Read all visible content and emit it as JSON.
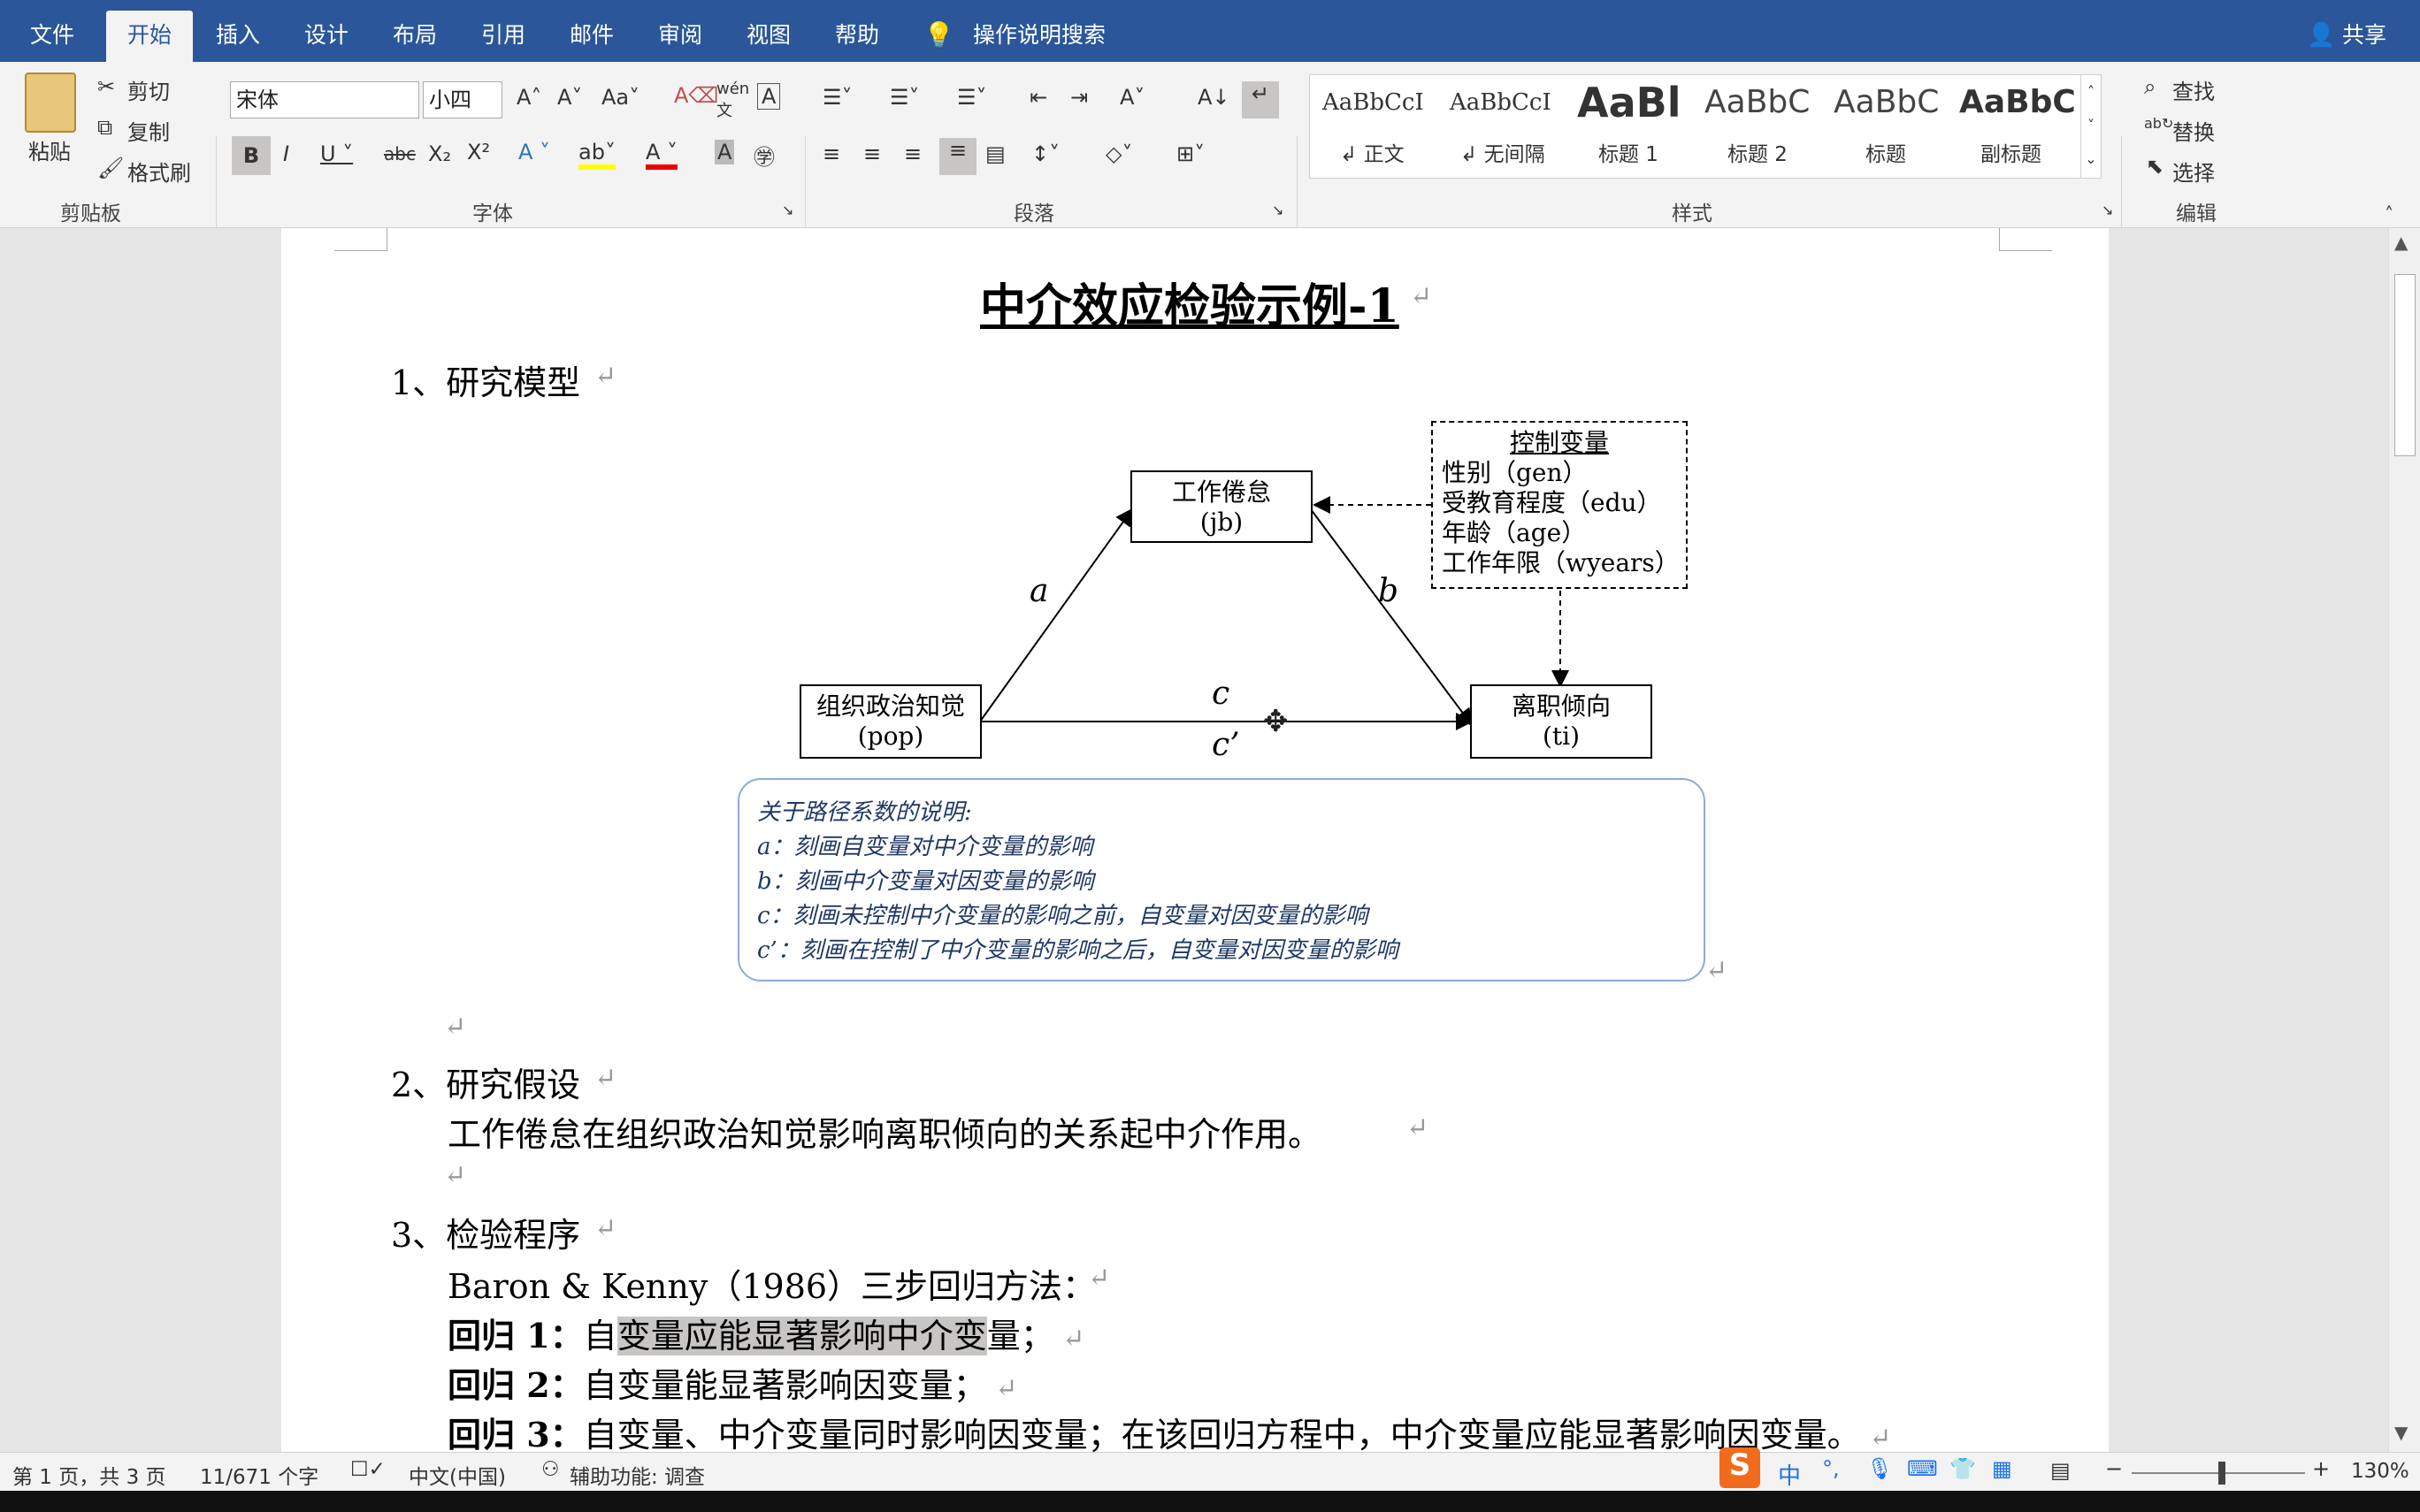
{
  "tabs": [
    "文件",
    "开始",
    "插入",
    "设计",
    "布局",
    "引用",
    "邮件",
    "审阅",
    "视图",
    "帮助"
  ],
  "active_tab": "开始",
  "tell_me": "操作说明搜索",
  "share": "共享",
  "clipboard": {
    "paste": "粘贴",
    "cut": "剪切",
    "copy": "复制",
    "format_painter": "格式刷",
    "group": "剪贴板"
  },
  "font": {
    "name": "宋体",
    "size": "小四",
    "group": "字体"
  },
  "paragraph": {
    "group": "段落"
  },
  "styles": {
    "group": "样式",
    "items": [
      {
        "preview": "AaBbCcI",
        "name": "↲ 正文"
      },
      {
        "preview": "AaBbCcI",
        "name": "↲ 无间隔"
      },
      {
        "preview": "AaBl",
        "name": "标题 1"
      },
      {
        "preview": "AaBbC",
        "name": "标题 2"
      },
      {
        "preview": "AaBbC",
        "name": "标题"
      },
      {
        "preview": "AaBbC",
        "name": "副标题"
      }
    ]
  },
  "editing": {
    "find": "查找",
    "replace": "替换",
    "select": "选择",
    "group": "编辑"
  },
  "document": {
    "title": "中介效应检验示例-1",
    "h1": "1、研究模型",
    "diagram": {
      "node_jb": [
        "工作倦怠",
        "(jb)"
      ],
      "node_pop": [
        "组织政治知觉",
        "(pop)"
      ],
      "node_ti": [
        "离职倾向",
        "(ti)"
      ],
      "control_title": "控制变量",
      "control_items": [
        "性别（gen）",
        "受教育程度（edu）",
        "年龄（age）",
        "工作年限（wyears）"
      ],
      "path_a": "a",
      "path_b": "b",
      "path_c": "c",
      "path_c2": "c’",
      "note_title": "关于路径系数的说明:",
      "notes": [
        "a：刻画自变量对中介变量的影响",
        "b：刻画中介变量对因变量的影响",
        "c：刻画未控制中介变量的影响之前，自变量对因变量的影响",
        "c’：刻画在控制了中介变量的影响之后，自变量对因变量的影响"
      ]
    },
    "h2": "2、研究假设",
    "hypothesis": "工作倦怠在组织政治知觉影响离职倾向的关系起中介作用。",
    "h3": "3、检验程序",
    "method": "Baron & Kenny（1986）三步回归方法：",
    "reg1_label": "回归 1：",
    "reg1_pre": "自",
    "reg1_hl": "变量应能显著影响中介变",
    "reg1_post": "量；",
    "reg2_label": "回归 2：",
    "reg2": "自变量能显著影响因变量；",
    "reg3_label": "回归 3：",
    "reg3": "自变量、中介变量同时影响因变量；在该回归方程中，中介变量应能显著影响因变量。"
  },
  "status": {
    "page": "第 1 页，共 3 页",
    "words": "11/671 个字",
    "lang": "中文(中国)",
    "accessibility": "辅助功能: 调查",
    "zoom": "130%"
  },
  "colors": {
    "brand": "#2b579a",
    "highlight": "#c8c6c4",
    "note_text": "#1f3864"
  }
}
